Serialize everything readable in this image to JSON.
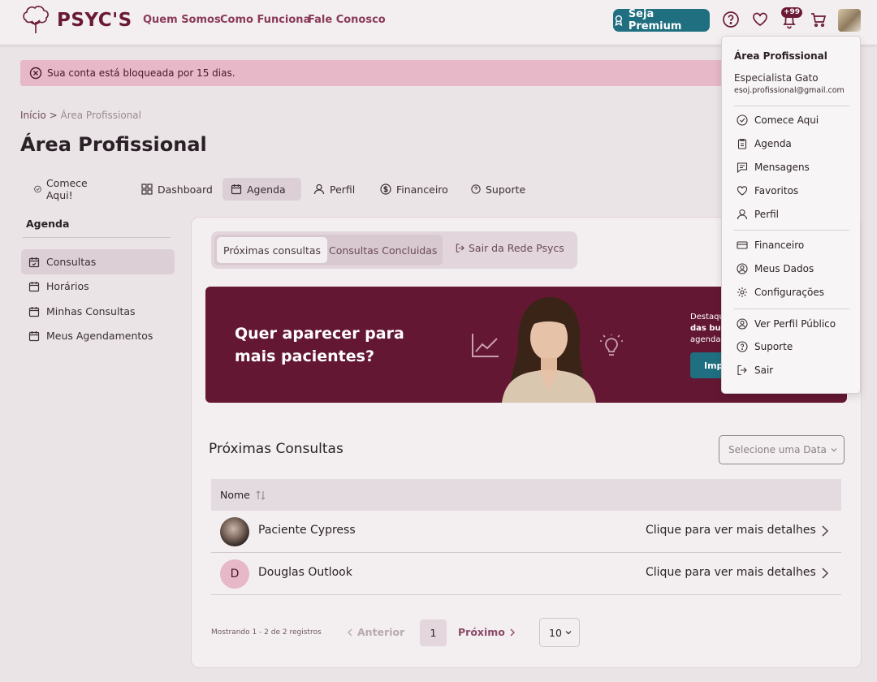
{
  "header": {
    "brand": "PSYC'S",
    "nav": [
      "Quem Somos",
      "Como Funciona",
      "Fale Conosco"
    ],
    "premium_label": "Seja Premium",
    "notif_badge": "+99"
  },
  "alert": {
    "text": "Sua conta está bloqueada por 15 dias."
  },
  "breadcrumb": {
    "home": "Início",
    "sep": ">",
    "current": "Área Profissional"
  },
  "page_title": "Área Profissional",
  "tabs": [
    "Comece Aqui!",
    "Dashboard",
    "Agenda",
    "Perfil",
    "Financeiro",
    "Suporte"
  ],
  "sidebar": {
    "heading": "Agenda",
    "items": [
      "Consultas",
      "Horários",
      "Minhas Consultas",
      "Meus Agendamentos"
    ]
  },
  "subtabs": [
    "Próximas consultas",
    "Consultas Concluidas",
    "Sair da Rede Psycs"
  ],
  "banner": {
    "headline": "Quer aparecer para mais pacientes?",
    "side_line1": "Destaqu",
    "side_line2": "das bus",
    "side_line3": "agenda",
    "button": "Imp"
  },
  "section": {
    "title": "Próximas Consultas",
    "date_placeholder": "Selecione uma Data"
  },
  "table": {
    "col_name": "Nome",
    "rows": [
      {
        "name": "Paciente Cypress",
        "link": "Clique para ver mais detalhes",
        "initial": ""
      },
      {
        "name": "Douglas Outlook",
        "link": "Clique para ver mais detalhes",
        "initial": "D"
      }
    ]
  },
  "pagination": {
    "info": "Mostrando 1 - 2 de 2 registros",
    "prev": "Anterior",
    "page": "1",
    "next": "Próximo",
    "per_page": "10"
  },
  "dropdown": {
    "heading": "Área Profissional",
    "name": "Especialista Gato",
    "email": "esoj.profissional@gmail.com",
    "items": [
      "Comece Aqui",
      "Agenda",
      "Mensagens",
      "Favoritos",
      "Perfil",
      "Financeiro",
      "Meus Dados",
      "Configurações",
      "Ver Perfil Público",
      "Suporte",
      "Sair"
    ]
  },
  "colors": {
    "brand": "#6b1a35",
    "accent": "#1f6f80",
    "banner_bg": "#641733",
    "alert_bg": "#e6b8c8"
  }
}
